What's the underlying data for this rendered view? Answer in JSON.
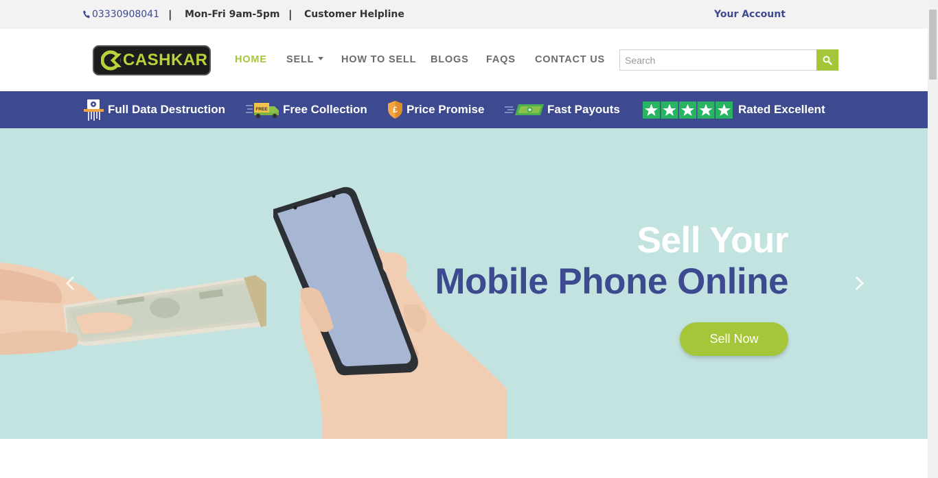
{
  "topbar": {
    "phone": "03330908041",
    "separator": "|",
    "hours": "Mon-Fri 9am-5pm",
    "helpline": "Customer Helpline",
    "account": "Your Account"
  },
  "brand": {
    "logo_text": "CASHKAR",
    "accent_color": "#a6c63a",
    "primary_color": "#3e4a8f"
  },
  "nav": {
    "items": [
      {
        "label": "HOME",
        "active": true
      },
      {
        "label": "SELL",
        "dropdown": true
      },
      {
        "label": "HOW TO SELL"
      },
      {
        "label": "BLOGS"
      },
      {
        "label": "FAQS"
      },
      {
        "label": "CONTACT US"
      }
    ]
  },
  "search": {
    "placeholder": "Search",
    "icon": "search-icon"
  },
  "features": [
    {
      "label": "Full Data Destruction",
      "icon": "data-destruction-icon"
    },
    {
      "label": "Free Collection",
      "icon": "free-truck-icon",
      "badge": "FREE"
    },
    {
      "label": "Price Promise",
      "icon": "shield-pound-icon",
      "badge": "£"
    },
    {
      "label": "Fast Payouts",
      "icon": "fast-cash-icon"
    },
    {
      "label": "Rated Excellent",
      "icon": "five-stars-icon",
      "rating": 5
    }
  ],
  "hero": {
    "title_line1": "Sell Your",
    "title_line2": "Mobile Phone Online",
    "cta": "Sell Now",
    "background": "#c3e3e0"
  }
}
